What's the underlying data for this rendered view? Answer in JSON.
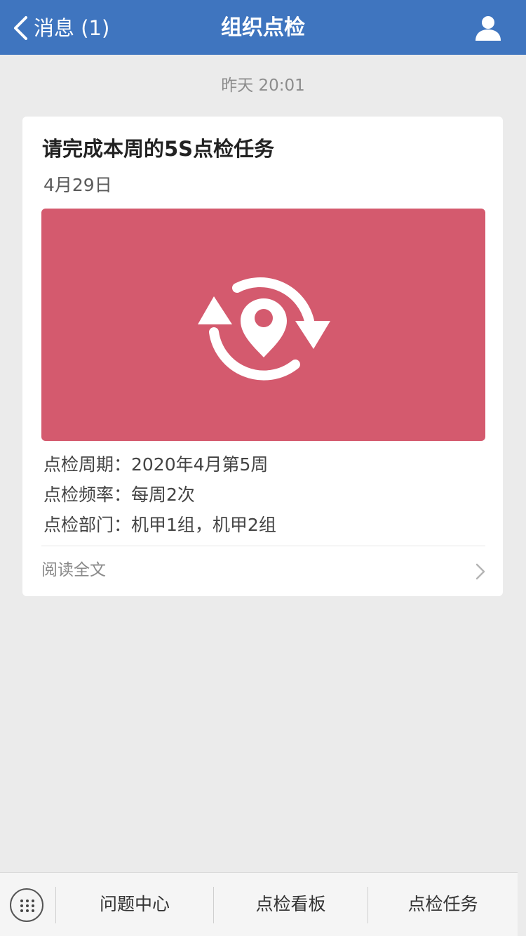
{
  "nav": {
    "back_label": "消息 (1)",
    "title": "组织点检",
    "bar_color": "#3f75bf",
    "back_icon": "chevron-left-icon",
    "user_icon": "user-icon"
  },
  "timestamp": "昨天 20:01",
  "card": {
    "title": "请完成本周的5S点检任务",
    "date": "4月29日",
    "cover_color": "#d45a6e",
    "cover_icon": "location-refresh-icon",
    "info": [
      "点检周期：2020年4月第5周",
      "点检频率：每周2次",
      "点检部门：机甲1组，机甲2组"
    ],
    "read_label": "阅读全文",
    "read_icon": "chevron-right-icon"
  },
  "tabbar": {
    "keyboard_icon": "keyboard-grid-icon",
    "tabs": [
      {
        "label": "问题中心"
      },
      {
        "label": "点检看板"
      },
      {
        "label": "点检任务"
      }
    ]
  }
}
